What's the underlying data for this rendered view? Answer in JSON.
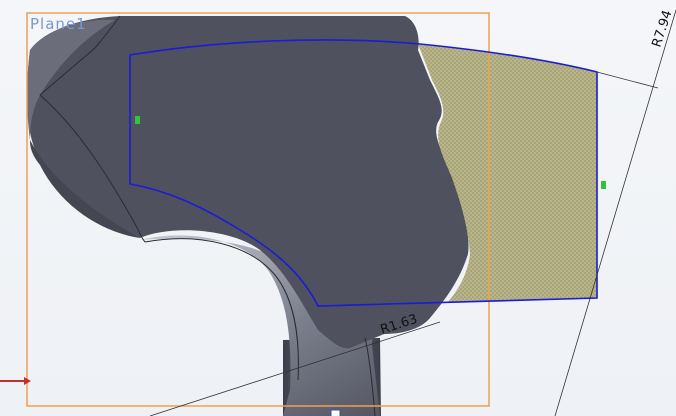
{
  "plane": {
    "label": "Plane1"
  },
  "dimensions": {
    "radius_large": "R7.94",
    "radius_small": "R1.63"
  },
  "colors": {
    "body_dark": "#4d4f5c",
    "body_mid": "#5f6170",
    "body_light": "#9fa2ae",
    "sketch_line": "#1b1bd8",
    "plane_border": "#f0a050",
    "hatch_fill": "#b9b68c",
    "handle": "#2fc43b",
    "triad_arrow": "#c33030"
  }
}
